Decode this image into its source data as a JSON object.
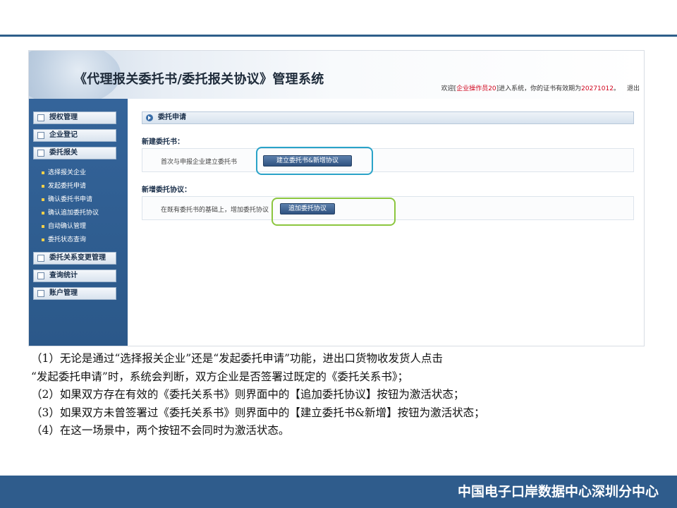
{
  "app": {
    "title": "《代理报关委托书/委托报关协议》管理系统",
    "welcome_prefix": "欢迎[",
    "user": "企业操作员20",
    "welcome_mid": "]进入系统，你的证书有效期为",
    "cert_expiry": "20271012",
    "welcome_suffix": "。",
    "logout": "退出"
  },
  "sidebar": {
    "menus": [
      {
        "label": "授权管理"
      },
      {
        "label": "企业登记"
      },
      {
        "label": "委托报关"
      },
      {
        "label": "委托关系变更管理"
      },
      {
        "label": "查询统计"
      },
      {
        "label": "账户管理"
      }
    ],
    "subitems": [
      {
        "label": "选择报关企业"
      },
      {
        "label": "发起委托申请"
      },
      {
        "label": "确认委托书申请"
      },
      {
        "label": "确认追加委托协议"
      },
      {
        "label": "自动确认管理"
      },
      {
        "label": "委托状态查询"
      }
    ]
  },
  "main": {
    "section_title": "委托申请",
    "new_entrust": {
      "heading": "新建委托书：",
      "desc": "首次与申报企业建立委托书",
      "button": "建立委托书&新增协议"
    },
    "add_agreement": {
      "heading": "新增委托协议：",
      "desc": "在既有委托书的基础上，增加委托协议",
      "button": "追加委托协议"
    }
  },
  "caption": {
    "lines": [
      "（1）无论是通过“选择报关企业”还是“发起委托申请”功能，进出口货物收发货人点击",
      "“发起委托申请”时，系统会判断，双方企业是否签署过既定的《委托关系书》；",
      "（2）如果双方存在有效的《委托关系书》则界面中的【追加委托协议】按钮为激活状态；",
      "（3）如果双方未曾签署过《委托关系书》则界面中的【建立委托书&新增】按钮为激活状态；",
      "（4）在这一场景中，两个按钮不会同时为激活状态。"
    ]
  },
  "footer": {
    "text": "中国电子口岸数据中心深圳分中心"
  },
  "colors": {
    "sidebar": "#2f5c8c",
    "footer": "#2f5c8c",
    "highlight_blue": "#2aa3c8",
    "highlight_green": "#8cc63f",
    "accent_red": "#d0021b"
  }
}
